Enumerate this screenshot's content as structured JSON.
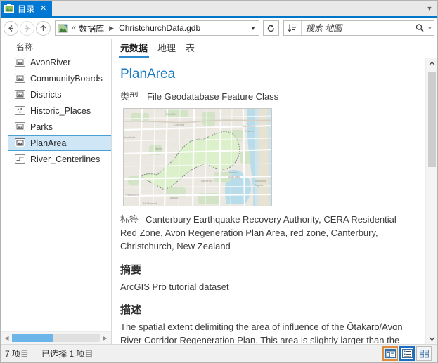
{
  "window": {
    "tab_label": "目录",
    "tab_icon": "catalog-icon",
    "close_label": "✕",
    "menu_caret": "▼"
  },
  "toolbar": {
    "back_title": "后退",
    "forward_title": "前进",
    "up_title": "上一级",
    "path_icon": "folder-connection-icon",
    "path_overflow": "«",
    "path_segments": [
      "数据库",
      "ChristchurchData.gdb"
    ],
    "path_separator": "▶",
    "path_dropdown": "▼",
    "refresh_label": "↻",
    "sort_label": "sort-icon",
    "search_placeholder": "搜索 地图",
    "search_value": "",
    "search_icon": "magnifier-icon",
    "search_dropdown": "▾"
  },
  "sidebar": {
    "column_header": "名称",
    "items": [
      {
        "label": "AvonRiver",
        "icon": "polygon-feature-icon",
        "selected": false
      },
      {
        "label": "CommunityBoards",
        "icon": "polygon-feature-icon",
        "selected": false
      },
      {
        "label": "Districts",
        "icon": "polygon-feature-icon",
        "selected": false
      },
      {
        "label": "Historic_Places",
        "icon": "point-feature-icon",
        "selected": false
      },
      {
        "label": "Parks",
        "icon": "polygon-feature-icon",
        "selected": false
      },
      {
        "label": "PlanArea",
        "icon": "polygon-feature-icon",
        "selected": true
      },
      {
        "label": "River_Centerlines",
        "icon": "line-feature-icon",
        "selected": false
      }
    ],
    "hscroll": {
      "left_arrow": "◀",
      "right_arrow": "▶",
      "thumb_percent": 47
    }
  },
  "content": {
    "tabs": [
      {
        "label": "元数据",
        "active": true
      },
      {
        "label": "地理",
        "active": false
      },
      {
        "label": "表",
        "active": false
      }
    ],
    "title": "PlanArea",
    "type_key": "类型",
    "type_value": "File Geodatabase Feature Class",
    "thumbnail_alt": "PlanArea 地图缩略图",
    "tags_key": "标签",
    "tags_value": "Canterbury Earthquake Recovery Authority, CERA Residential Red Zone, Avon Regeneration Plan Area, red zone, Canterbury, Christchurch, New Zealand",
    "summary_heading": "摘要",
    "summary_body": "ArcGIS Pro tutorial dataset",
    "description_heading": "描述",
    "description_body": "The spatial extent delimiting the area of influence of the Ōtākaro/Avon River Corridor Regeneration Plan. This area is slightly larger than the",
    "vscroll": {
      "up_arrow": "⌃",
      "down_arrow": "⌄",
      "thumb_percent": 36
    }
  },
  "statusbar": {
    "item_count_text": "7 项目",
    "selection_text": "已选择 1 项目",
    "view_buttons": [
      {
        "name": "details-view-button",
        "state": "orange-focus"
      },
      {
        "name": "list-view-button",
        "state": "blue-selected"
      },
      {
        "name": "tile-view-button",
        "state": "plain"
      }
    ]
  },
  "colors": {
    "accent_blue": "#0078d4",
    "tab_underline": "#2e8bd0",
    "title_link": "#1b7cc2",
    "selection_fill": "#cfe6f7",
    "selection_border": "#4a9fd4",
    "focus_orange": "#e08a3c",
    "scrollbar_thumb_blue": "#6cb5e8"
  }
}
